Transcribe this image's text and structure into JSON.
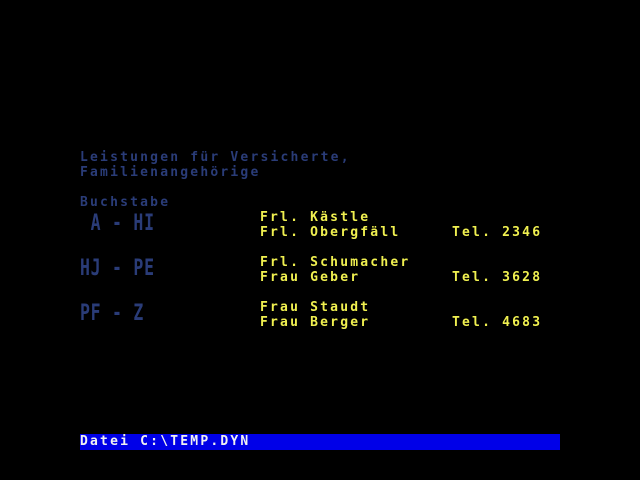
{
  "header": {
    "line1": "Leistungen für Versicherte,",
    "line2": "Familienangehörige",
    "letter_label": "Buchstabe"
  },
  "groups": [
    {
      "range": " A - HI",
      "contacts": [
        {
          "name": "Frl. Kästle",
          "phone": ""
        },
        {
          "name": "Frl. Obergfäll",
          "phone": "Tel. 2346"
        }
      ]
    },
    {
      "range": "HJ - PE",
      "contacts": [
        {
          "name": "Frl. Schumacher",
          "phone": ""
        },
        {
          "name": "Frau Geber",
          "phone": "Tel. 3628"
        }
      ]
    },
    {
      "range": "PF - Z",
      "contacts": [
        {
          "name": "Frau Staudt",
          "phone": ""
        },
        {
          "name": "Frau Berger",
          "phone": "Tel. 4683"
        }
      ]
    }
  ],
  "status": {
    "text": "Datei C:\\TEMP.DYN"
  },
  "colors": {
    "background": "#000000",
    "dim_text": "#2a3c78",
    "highlight_text": "#f0f050",
    "status_bar": "#0000e8"
  }
}
